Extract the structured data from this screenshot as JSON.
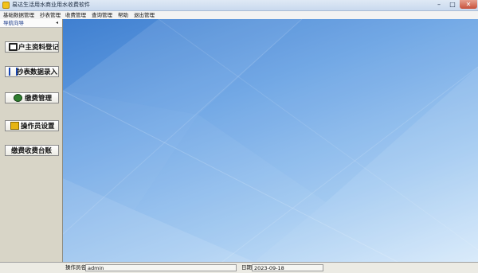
{
  "window": {
    "title": "易达生活用水商业用水收费软件",
    "icon": "app-icon",
    "controls": {
      "minimize": "–",
      "maximize": "□",
      "close": "✕"
    }
  },
  "menubar": {
    "items": [
      "基础数据管理",
      "抄表管理",
      "收费管理",
      "查询管理",
      "帮助",
      "退出管理"
    ]
  },
  "nav": {
    "header": "导航向导",
    "collapse_glyph": "◂",
    "buttons": [
      {
        "label": "户主资料登记",
        "icon": "registration-icon"
      },
      {
        "label": "抄表数据录入",
        "icon": "data-input-icon"
      },
      {
        "label": "缴费管理",
        "icon": "payment-icon"
      },
      {
        "label": "操作员设置",
        "icon": "operator-icon"
      },
      {
        "label": "缴费收费台账",
        "icon": ""
      }
    ]
  },
  "status": {
    "operator_label": "操作员名",
    "operator_value": "admin",
    "date_label": "日期",
    "date_value": "2023-09-18"
  },
  "colors": {
    "main_bg_dark": "#3f7fd0",
    "main_bg_light": "#d4e8fa",
    "nav_bg": "#d8d5c7",
    "close_button": "#c7503a"
  }
}
